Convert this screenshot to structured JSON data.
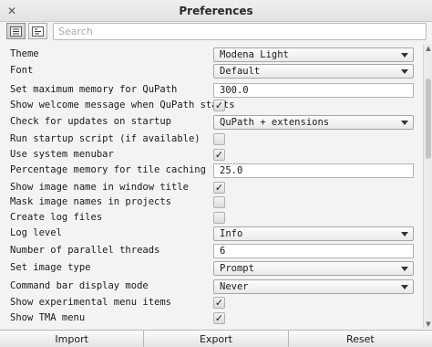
{
  "window": {
    "title": "Preferences",
    "close_glyph": "✕"
  },
  "toolbar": {
    "view_categorized_icon": "list-view-icon",
    "view_alphabetical_icon": "sort-view-icon",
    "search_placeholder": "Search"
  },
  "prefs": [
    {
      "label": "Theme",
      "type": "combo",
      "value": "Modena Light"
    },
    {
      "label": "Font",
      "type": "combo",
      "value": "Default"
    },
    {
      "label": "Set maximum memory for QuPath",
      "type": "text",
      "value": "300.0"
    },
    {
      "label": "Show welcome message when QuPath starts",
      "type": "check",
      "value": true
    },
    {
      "label": "Check for updates on startup",
      "type": "combo",
      "value": "QuPath + extensions"
    },
    {
      "label": "Run startup script (if available)",
      "type": "check",
      "value": false
    },
    {
      "label": "Use system menubar",
      "type": "check",
      "value": true
    },
    {
      "label": "Percentage memory for tile caching",
      "type": "text",
      "value": "25.0"
    },
    {
      "label": "Show image name in window title",
      "type": "check",
      "value": true
    },
    {
      "label": "Mask image names in projects",
      "type": "check",
      "value": false
    },
    {
      "label": "Create log files",
      "type": "check",
      "value": false
    },
    {
      "label": "Log level",
      "type": "combo",
      "value": "Info"
    },
    {
      "label": "Number of parallel threads",
      "type": "text",
      "value": "6"
    },
    {
      "label": "Set image type",
      "type": "combo",
      "value": "Prompt"
    },
    {
      "label": "Command bar display mode",
      "type": "combo",
      "value": "Never"
    },
    {
      "label": "Show experimental menu items",
      "type": "check",
      "value": true
    },
    {
      "label": "Show TMA menu",
      "type": "check",
      "value": true
    }
  ],
  "footer": {
    "import_label": "Import",
    "export_label": "Export",
    "reset_label": "Reset"
  }
}
